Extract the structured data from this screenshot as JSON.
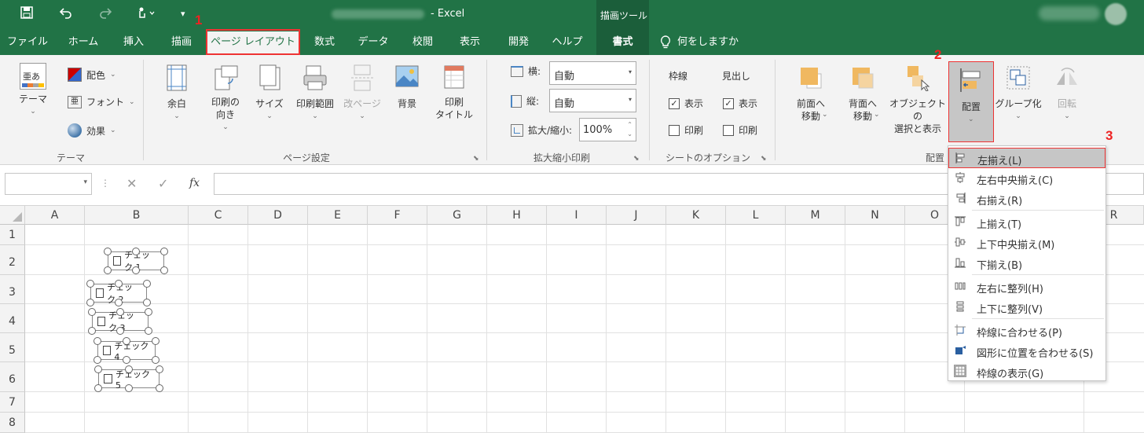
{
  "window": {
    "title_suffix": "- Excel",
    "context_tab_group": "描画ツール"
  },
  "tabs": [
    "ファイル",
    "ホーム",
    "挿入",
    "描画",
    "ページ レイアウト",
    "数式",
    "データ",
    "校閲",
    "表示",
    "開発",
    "ヘルプ",
    "書式"
  ],
  "tell_me": "何をしますか",
  "step_numbers": [
    "1",
    "2",
    "3"
  ],
  "ribbon": {
    "theme": {
      "themes_label": "テーマ",
      "colors_label": "配色",
      "fonts_label": "フォント",
      "effects_label": "効果",
      "group_label": "テーマ",
      "preview_glyph": "亜あ"
    },
    "page_setup": {
      "margins": "余白",
      "orientation": "印刷の\n向き",
      "size": "サイズ",
      "print_area": "印刷範囲",
      "breaks": "改ページ",
      "background": "背景",
      "print_titles": "印刷\nタイトル",
      "group_label": "ページ設定"
    },
    "scale": {
      "width_label": "横:",
      "width_value": "自動",
      "height_label": "縦:",
      "height_value": "自動",
      "scale_label": "拡大/縮小:",
      "scale_value": "100%",
      "group_label": "拡大縮小印刷"
    },
    "sheet_options": {
      "gridlines": "枠線",
      "headings": "見出し",
      "view": "表示",
      "print": "印刷",
      "group_label": "シートのオプション"
    },
    "arrange": {
      "bring_forward": "前面へ\n移動",
      "send_backward": "背面へ\n移動",
      "selection_pane": "オブジェクトの\n選択と表示",
      "align": "配置",
      "group": "グループ化",
      "rotate": "回転",
      "group_label": "配置"
    }
  },
  "formula_bar": {
    "fx": "fx",
    "cancel": "✕",
    "enter": "✓"
  },
  "columns": [
    "A",
    "B",
    "C",
    "D",
    "E",
    "F",
    "G",
    "H",
    "I",
    "J",
    "K",
    "L",
    "M",
    "N",
    "O",
    "R"
  ],
  "rows": [
    "1",
    "2",
    "3",
    "4",
    "5",
    "6",
    "7",
    "8"
  ],
  "checkboxes": [
    "チェック 1",
    "チェック 2",
    "チェック 3",
    "チェック 4",
    "チェック 5"
  ],
  "align_menu": [
    {
      "label": "左揃え(L)",
      "highlighted": true
    },
    {
      "label": "左右中央揃え(C)"
    },
    {
      "label": "右揃え(R)"
    },
    {
      "label": "上揃え(T)"
    },
    {
      "label": "上下中央揃え(M)"
    },
    {
      "label": "下揃え(B)"
    },
    {
      "label": "左右に整列(H)"
    },
    {
      "label": "上下に整列(V)"
    },
    {
      "label": "枠線に合わせる(P)"
    },
    {
      "label": "図形に位置を合わせる(S)"
    },
    {
      "label": "枠線の表示(G)"
    }
  ],
  "colors": {
    "excel_green": "#217346",
    "highlight": "#c6c6c6",
    "annotation_red": "#e22222"
  }
}
